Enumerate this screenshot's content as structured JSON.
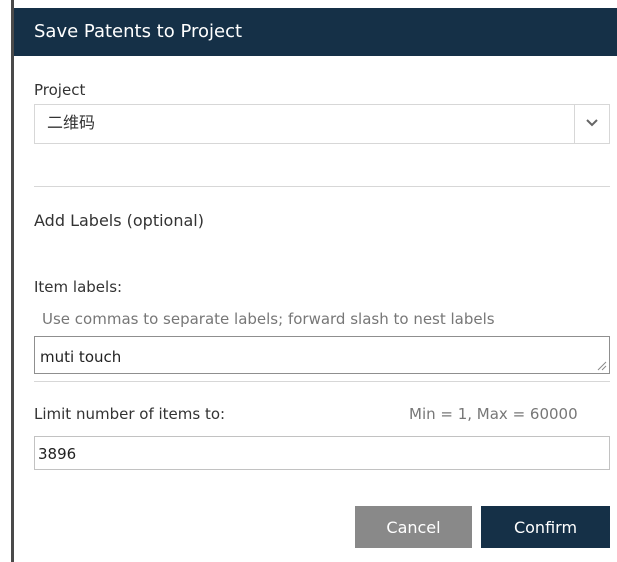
{
  "dialog": {
    "title": "Save Patents to Project"
  },
  "project": {
    "label": "Project",
    "selected_value": "二维码"
  },
  "labels_section": {
    "heading": "Add Labels (optional)",
    "item_labels_label": "Item labels:",
    "hint": "Use commas to separate labels; forward slash to nest labels",
    "item_labels_value": "muti touch"
  },
  "limit": {
    "label": "Limit number of items to:",
    "range_text": "Min = 1, Max = 60000",
    "value": "3896"
  },
  "buttons": {
    "cancel": "Cancel",
    "confirm": "Confirm"
  },
  "colors": {
    "header_bg": "#153047",
    "confirm_bg": "#153047",
    "cancel_bg": "#898989"
  },
  "icons": {
    "dropdown": "chevron-down-icon",
    "resize": "resize-handle-icon"
  }
}
